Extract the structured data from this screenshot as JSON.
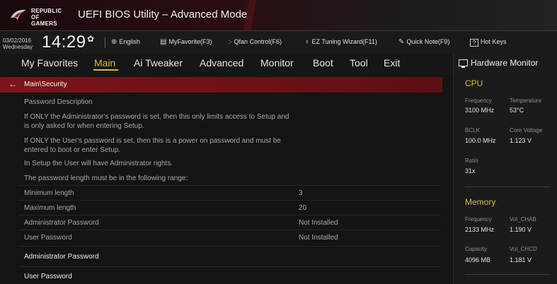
{
  "header": {
    "brand_line1": "REPUBLIC OF",
    "brand_line2": "GAMERS",
    "title": "UEFI BIOS Utility – Advanced Mode"
  },
  "infobar": {
    "date": "03/02/2016",
    "weekday": "Wednesday",
    "time": "14:29",
    "language": "English",
    "myfavorite": "MyFavorite(F3)",
    "qfan": "Qfan Control(F6)",
    "ez_tuning": "EZ Tuning Wizard(F11)",
    "quick_note": "Quick Note(F9)",
    "hot_keys": "Hot Keys"
  },
  "menu": {
    "items": [
      "My Favorites",
      "Main",
      "Ai Tweaker",
      "Advanced",
      "Monitor",
      "Boot",
      "Tool",
      "Exit"
    ],
    "active": "Main"
  },
  "breadcrumb": "Main\\Security",
  "content": {
    "lines": [
      "Password Description",
      "If ONLY the Administrator's password is set, then this only limits access to Setup and",
      "is only asked for when entering Setup.",
      "If ONLY the User's password is set, then this is a power on password and must be",
      "entered to boot or enter Setup.",
      "In Setup the User will have Administrator rights.",
      "The password length must be in the following range:"
    ],
    "settings": [
      {
        "label": "Minimum length",
        "value": "3"
      },
      {
        "label": "Maximum length",
        "value": "20"
      },
      {
        "label": "Administrator Password",
        "value": "Not Installed"
      },
      {
        "label": "User Password",
        "value": "Not Installed"
      }
    ],
    "links": [
      "Administrator Password",
      "User Password"
    ]
  },
  "hardware_monitor": {
    "title": "Hardware Monitor",
    "cpu": {
      "section": "CPU",
      "frequency_label": "Frequency",
      "frequency": "3100 MHz",
      "temperature_label": "Temperature",
      "temperature": "53°C",
      "bclk_label": "BCLK",
      "bclk": "100.0 MHz",
      "core_voltage_label": "Core Voltage",
      "core_voltage": "1.123 V",
      "ratio_label": "Ratio",
      "ratio": "31x"
    },
    "memory": {
      "section": "Memory",
      "frequency_label": "Frequency",
      "frequency": "2133 MHz",
      "vol_chab_label": "Vol_CHAB",
      "vol_chab": "1.190 V",
      "capacity_label": "Capacity",
      "capacity": "4096 MB",
      "vol_chcd_label": "Vol_CHCD",
      "vol_chcd": "1.181 V"
    }
  },
  "colors": {
    "accent_gold": "#d6b84a",
    "breadcrumb_red": "#7a141b",
    "background": "#141414"
  }
}
